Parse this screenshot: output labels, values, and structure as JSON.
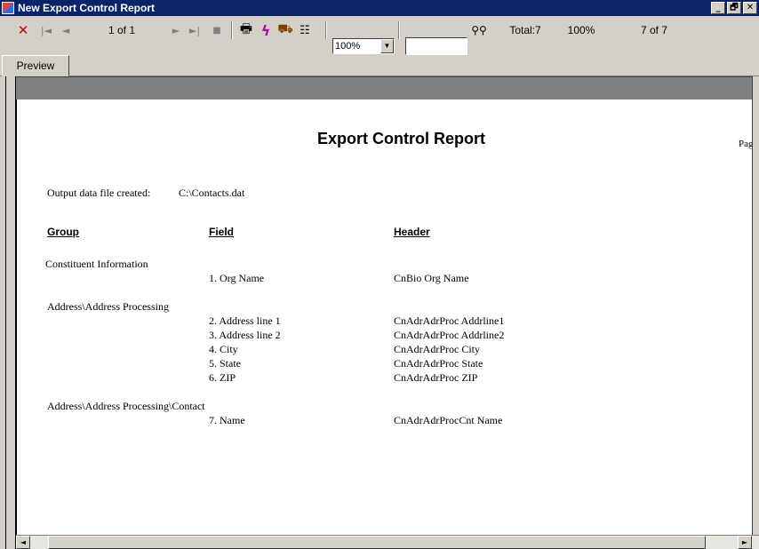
{
  "window": {
    "title": "New Export Control Report",
    "buttons": [
      "_",
      "🗗",
      "✕"
    ]
  },
  "toolbar": {
    "close": "✕",
    "first": "|◄",
    "prev": "◄",
    "page_indicator": "1 of 1",
    "next": "►",
    "last": "►|",
    "stop": "■",
    "print": "🖶",
    "export": "ϟ",
    "mail": "⛟",
    "tree": "☷",
    "zoom": "100%",
    "search_icon": "👓",
    "total": "Total:7",
    "percent": "100%",
    "count": "7 of 7"
  },
  "tabs": {
    "preview": "Preview"
  },
  "report": {
    "title": "Export Control Report",
    "page_label": "Pag",
    "output_label": "Output data file created:",
    "output_file": "C:\\Contacts.dat",
    "headers": {
      "group": "Group",
      "field": "Field",
      "header": "Header"
    },
    "sections": [
      {
        "group": "Constituent Information",
        "rows": [
          {
            "field": "1. Org Name",
            "header": "CnBio Org Name"
          }
        ]
      },
      {
        "group": "Address\\Address Processing",
        "rows": [
          {
            "field": "2. Address line 1",
            "header": "CnAdrAdrProc Addrline1"
          },
          {
            "field": "3. Address line 2",
            "header": "CnAdrAdrProc Addrline2"
          },
          {
            "field": "4. City",
            "header": "CnAdrAdrProc City"
          },
          {
            "field": "5. State",
            "header": "CnAdrAdrProc State"
          },
          {
            "field": "6. ZIP",
            "header": "CnAdrAdrProc ZIP"
          }
        ]
      },
      {
        "group": "Address\\Address Processing\\Contact",
        "rows": [
          {
            "field": "7. Name",
            "header": "CnAdrAdrProcCnt Name"
          }
        ]
      }
    ]
  },
  "colors": {
    "titlebar": "#0a246a",
    "close_red": "#cc0000",
    "face": "#d4d0c8"
  }
}
